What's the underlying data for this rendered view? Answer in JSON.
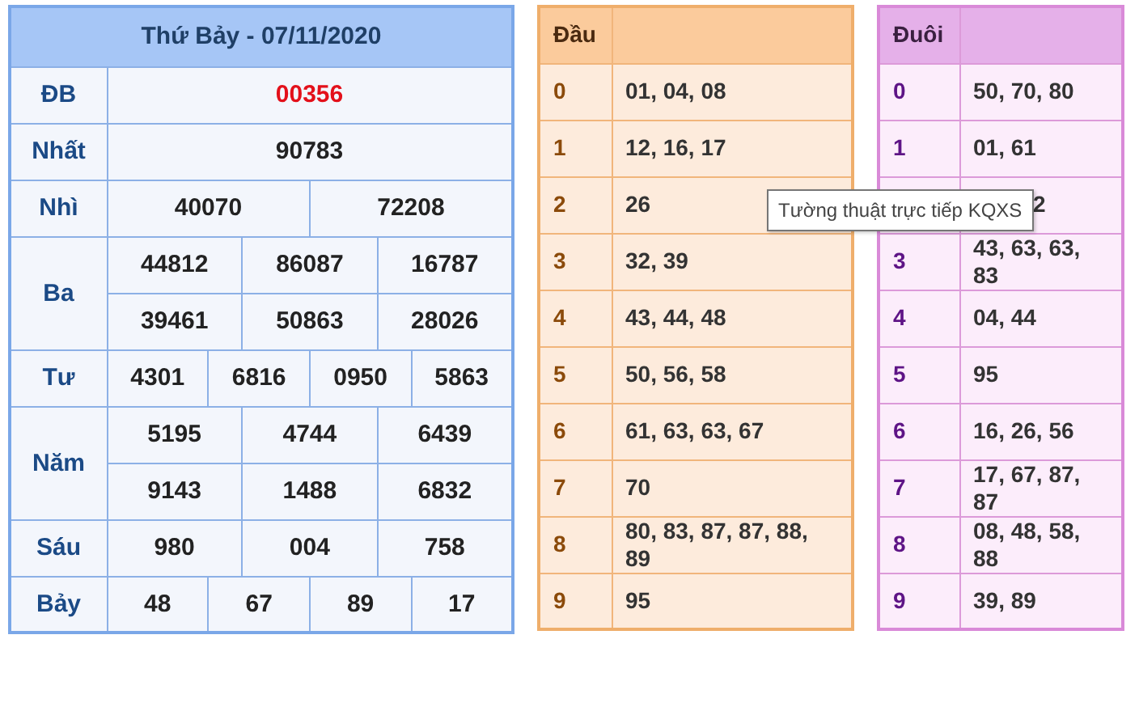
{
  "results": {
    "title": "Thứ Bảy - 07/11/2020",
    "prizes": [
      {
        "label": "ĐB",
        "kind": "special",
        "rows": [
          [
            "00356"
          ]
        ]
      },
      {
        "label": "Nhất",
        "kind": "regular",
        "rows": [
          [
            "90783"
          ]
        ]
      },
      {
        "label": "Nhì",
        "kind": "regular",
        "rows": [
          [
            "40070",
            "72208"
          ]
        ]
      },
      {
        "label": "Ba",
        "kind": "regular",
        "rows": [
          [
            "44812",
            "86087",
            "16787"
          ],
          [
            "39461",
            "50863",
            "28026"
          ]
        ]
      },
      {
        "label": "Tư",
        "kind": "regular",
        "rows": [
          [
            "4301",
            "6816",
            "0950",
            "5863"
          ]
        ]
      },
      {
        "label": "Năm",
        "kind": "regular",
        "rows": [
          [
            "5195",
            "4744",
            "6439"
          ],
          [
            "9143",
            "1488",
            "6832"
          ]
        ]
      },
      {
        "label": "Sáu",
        "kind": "regular",
        "rows": [
          [
            "980",
            "004",
            "758"
          ]
        ]
      },
      {
        "label": "Bảy",
        "kind": "regular",
        "rows": [
          [
            "48",
            "67",
            "89",
            "17"
          ]
        ]
      }
    ]
  },
  "dau": {
    "title": "Đầu",
    "rows": [
      {
        "digit": "0",
        "numbers": "01, 04, 08"
      },
      {
        "digit": "1",
        "numbers": "12, 16, 17"
      },
      {
        "digit": "2",
        "numbers": "26"
      },
      {
        "digit": "3",
        "numbers": "32, 39"
      },
      {
        "digit": "4",
        "numbers": "43, 44, 48"
      },
      {
        "digit": "5",
        "numbers": "50, 56, 58"
      },
      {
        "digit": "6",
        "numbers": "61, 63, 63, 67"
      },
      {
        "digit": "7",
        "numbers": "70"
      },
      {
        "digit": "8",
        "numbers": "80, 83, 87, 87, 88, 89"
      },
      {
        "digit": "9",
        "numbers": "95"
      }
    ]
  },
  "duoi": {
    "title": "Đuôi",
    "rows": [
      {
        "digit": "0",
        "numbers": "50, 70, 80"
      },
      {
        "digit": "1",
        "numbers": "01, 61"
      },
      {
        "numbers": "2"
      },
      {
        "digit": "3",
        "numbers": "43, 63, 63, 83"
      },
      {
        "digit": "4",
        "numbers": "04, 44"
      },
      {
        "digit": "5",
        "numbers": "95"
      },
      {
        "digit": "6",
        "numbers": "16, 26, 56"
      },
      {
        "digit": "7",
        "numbers": "17, 67, 87, 87"
      },
      {
        "digit": "8",
        "numbers": "08, 48, 58, 88"
      },
      {
        "digit": "9",
        "numbers": "39, 89"
      }
    ]
  },
  "tooltip": {
    "text": "Tường thuật trực tiếp KQXS"
  }
}
